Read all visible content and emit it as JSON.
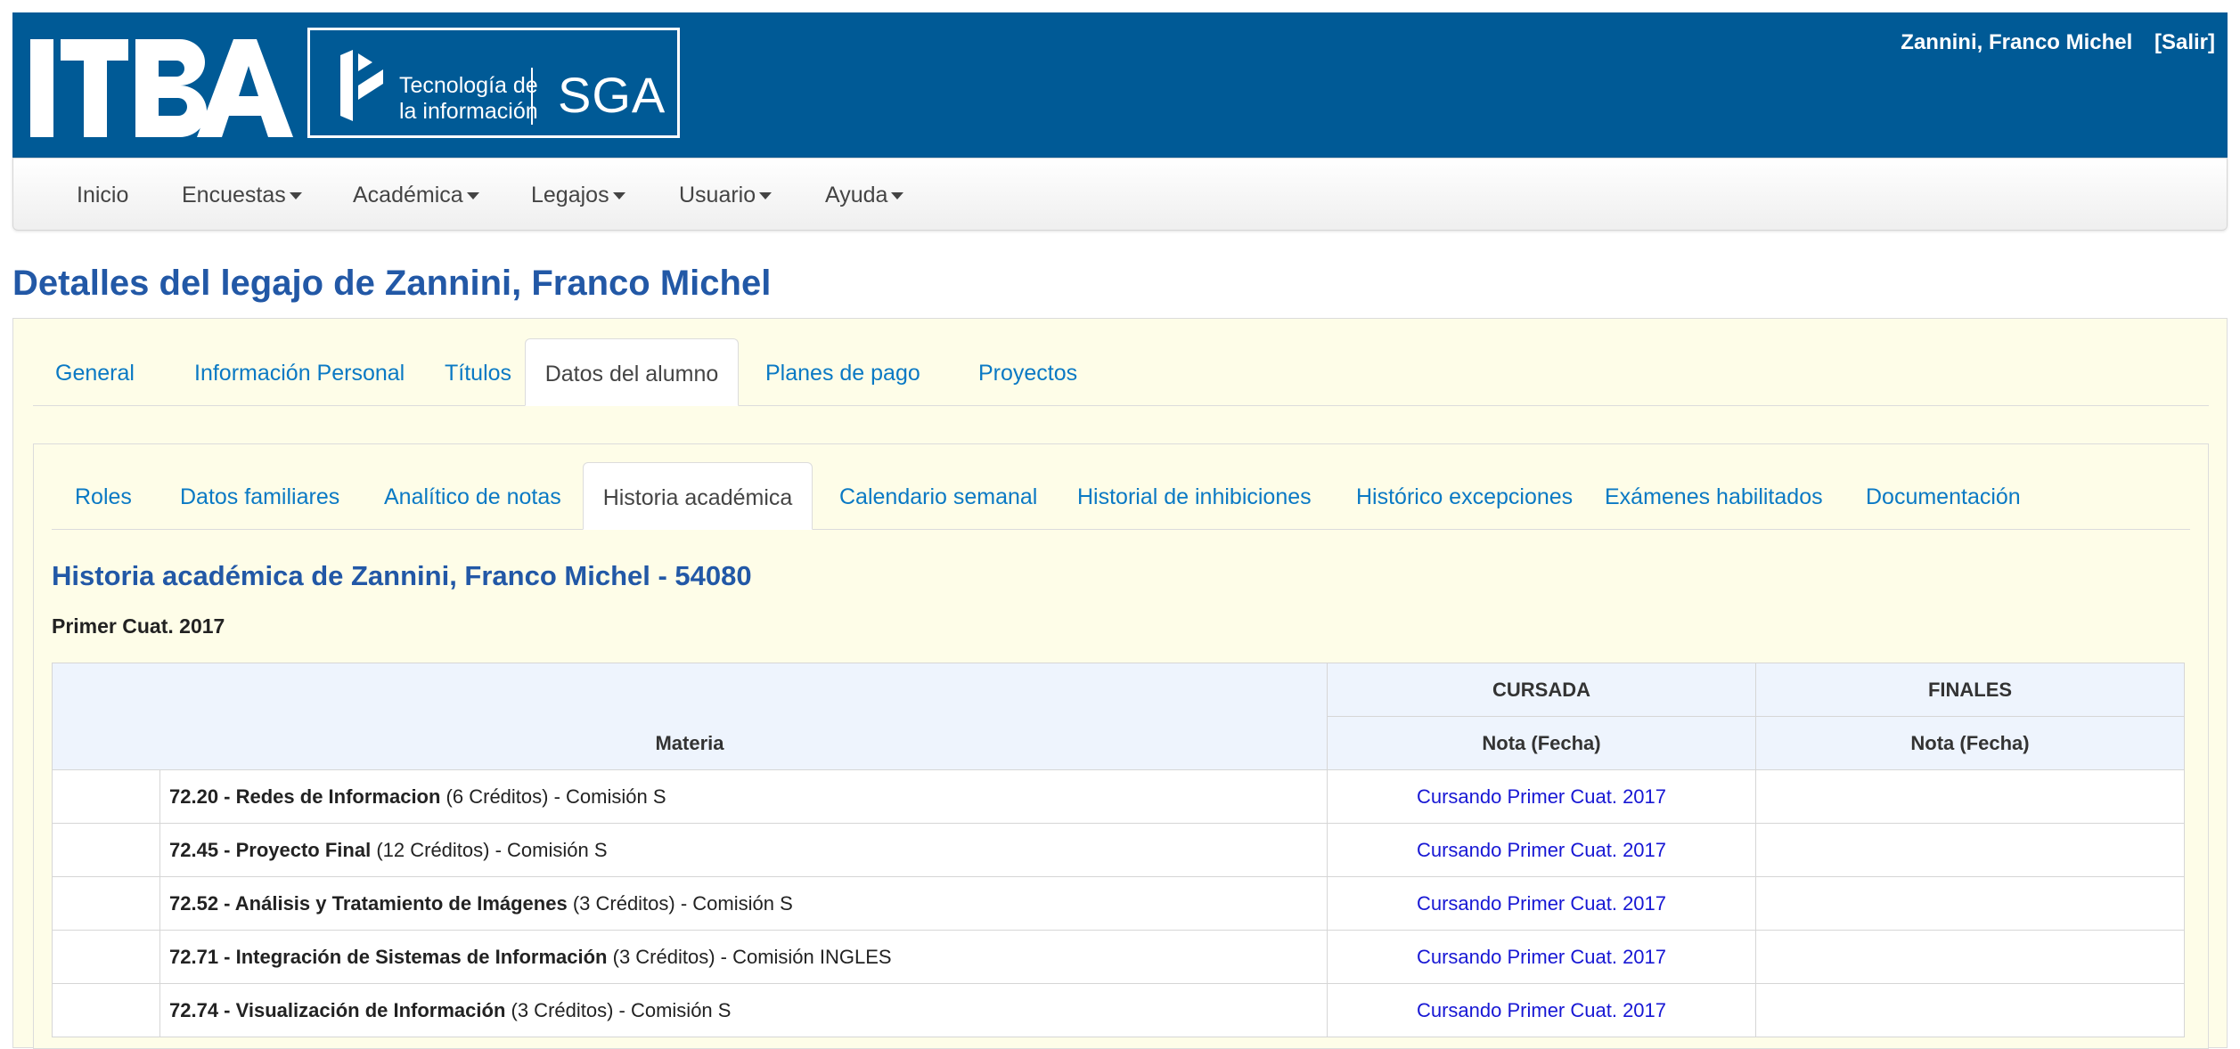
{
  "header": {
    "logo_text": "ITBA",
    "logo_tagline_line1": "Tecnología de",
    "logo_tagline_line2": "la información",
    "logo_system": "SGA",
    "user_name": "Zannini, Franco Michel",
    "logout_label": "[Salir]",
    "brand_color": "#005a96"
  },
  "nav": {
    "items": [
      {
        "label": "Inicio",
        "dropdown": false
      },
      {
        "label": "Encuestas",
        "dropdown": true
      },
      {
        "label": "Académica",
        "dropdown": true
      },
      {
        "label": "Legajos",
        "dropdown": true
      },
      {
        "label": "Usuario",
        "dropdown": true
      },
      {
        "label": "Ayuda",
        "dropdown": true
      }
    ]
  },
  "page": {
    "title": "Detalles del legajo de Zannini, Franco Michel",
    "title_color": "#2258a6"
  },
  "main_tabs": [
    {
      "label": "General",
      "active": false
    },
    {
      "label": "Información Personal",
      "active": false
    },
    {
      "label": "Títulos",
      "active": false
    },
    {
      "label": "Datos del alumno",
      "active": true
    },
    {
      "label": "Planes de pago",
      "active": false
    },
    {
      "label": "Proyectos",
      "active": false
    }
  ],
  "sub_tabs": [
    {
      "label": "Roles",
      "active": false
    },
    {
      "label": "Datos familiares",
      "active": false
    },
    {
      "label": "Analítico de notas",
      "active": false
    },
    {
      "label": "Historia académica",
      "active": true
    },
    {
      "label": "Calendario semanal",
      "active": false
    },
    {
      "label": "Historial de inhibiciones",
      "active": false
    },
    {
      "label": "Histórico excepciones",
      "active": false
    },
    {
      "label": "Exámenes habilitados",
      "active": false
    },
    {
      "label": "Documentación",
      "active": false
    }
  ],
  "history": {
    "title": "Historia académica de Zannini, Franco Michel - 54080",
    "term": "Primer Cuat. 2017",
    "table": {
      "header_cursada": "CURSADA",
      "header_finales": "FINALES",
      "header_materia": "Materia",
      "header_nota_cursada": "Nota (Fecha)",
      "header_nota_finales": "Nota (Fecha)",
      "rows": [
        {
          "code_name": "72.20 - Redes de Informacion",
          "details": " (6 Créditos) - Comisión S",
          "cursada": "Cursando Primer Cuat. 2017",
          "finales": ""
        },
        {
          "code_name": "72.45 - Proyecto Final",
          "details": " (12 Créditos) - Comisión S",
          "cursada": "Cursando Primer Cuat. 2017",
          "finales": ""
        },
        {
          "code_name": "72.52 - Análisis y Tratamiento de Imágenes",
          "details": " (3 Créditos) - Comisión S",
          "cursada": "Cursando Primer Cuat. 2017",
          "finales": ""
        },
        {
          "code_name": "72.71 - Integración de Sistemas de Información",
          "details": " (3 Créditos) - Comisión INGLES",
          "cursada": "Cursando Primer Cuat. 2017",
          "finales": ""
        },
        {
          "code_name": "72.74 - Visualización de Información",
          "details": " (3 Créditos) - Comisión S",
          "cursada": "Cursando Primer Cuat. 2017",
          "finales": ""
        }
      ]
    }
  }
}
